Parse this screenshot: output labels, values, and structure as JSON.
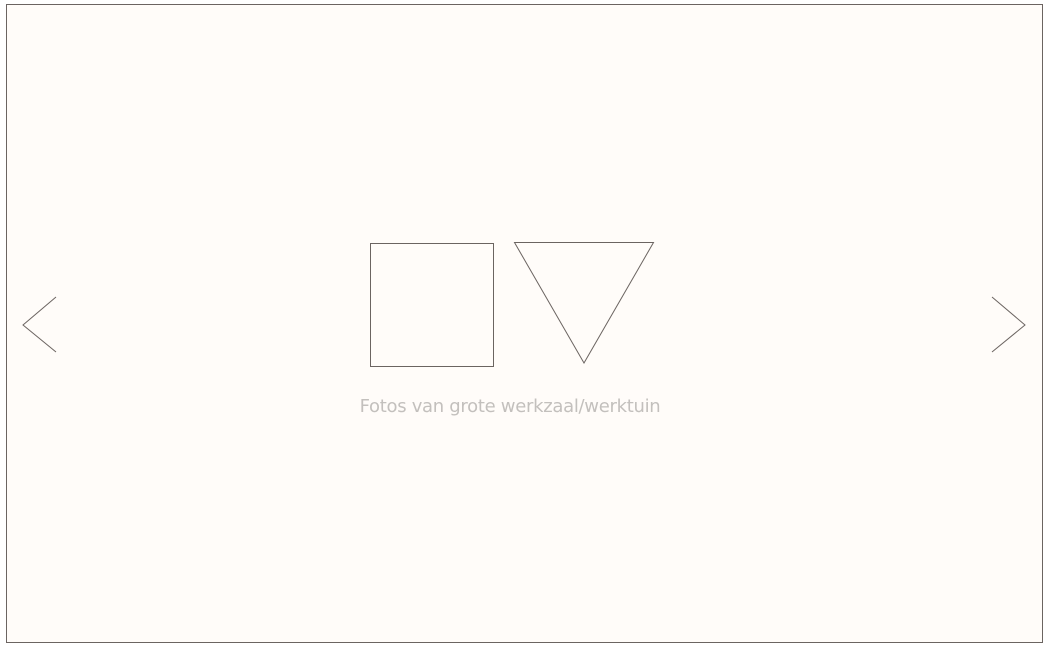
{
  "slideshow": {
    "caption": "Fotos van grote werkzaal/werktuin",
    "icons": {
      "previous": "chevron-left-icon",
      "next": "chevron-right-icon",
      "placeholder": "image-placeholder-icon"
    },
    "colors": {
      "background": "#fffcf9",
      "border": "#6b6461",
      "stroke": "#6b6461",
      "caption": "#c3c0bd"
    }
  }
}
